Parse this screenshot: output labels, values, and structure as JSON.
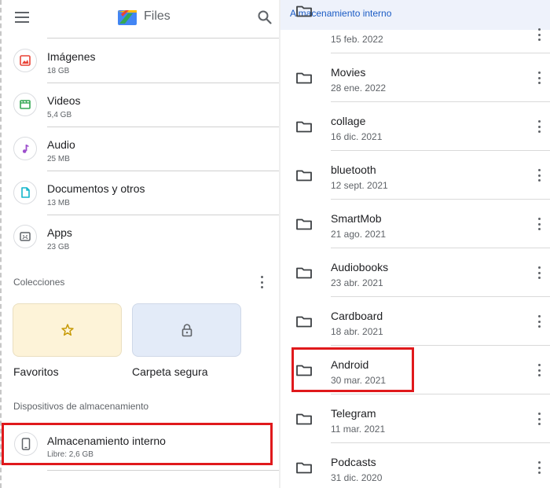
{
  "app": {
    "title": "Files"
  },
  "categories": [
    {
      "label": "Imágenes",
      "size": "18 GB",
      "icon": "image-icon",
      "color": "#e94235"
    },
    {
      "label": "Videos",
      "size": "5,4 GB",
      "icon": "video-icon",
      "color": "#34a853"
    },
    {
      "label": "Audio",
      "size": "25 MB",
      "icon": "music-note-icon",
      "color": "#9c4dcc"
    },
    {
      "label": "Documentos y otros",
      "size": "13 MB",
      "icon": "document-icon",
      "color": "#12b5cb"
    },
    {
      "label": "Apps",
      "size": "23 GB",
      "icon": "apps-icon",
      "color": "#5f6368"
    }
  ],
  "collections": {
    "label": "Colecciones",
    "items": [
      {
        "label": "Favoritos",
        "icon": "star-icon"
      },
      {
        "label": "Carpeta segura",
        "icon": "lock-icon"
      }
    ]
  },
  "storage": {
    "section_label": "Dispositivos de almacenamiento",
    "title": "Almacenamiento interno",
    "free": "Libre: 2,6 GB",
    "highlight_color": "#e0191c"
  },
  "browser": {
    "title": "Almacenamiento interno",
    "partial_date": "15 feb. 2022",
    "folders": [
      {
        "name": "Movies",
        "date": "28 ene. 2022"
      },
      {
        "name": "collage",
        "date": "16 dic. 2021"
      },
      {
        "name": "bluetooth",
        "date": "12 sept. 2021"
      },
      {
        "name": "SmartMob",
        "date": "21 ago. 2021"
      },
      {
        "name": "Audiobooks",
        "date": "23 abr. 2021"
      },
      {
        "name": "Cardboard",
        "date": "18 abr. 2021"
      },
      {
        "name": "Android",
        "date": "30 mar. 2021"
      },
      {
        "name": "Telegram",
        "date": "11 mar. 2021"
      },
      {
        "name": "Podcasts",
        "date": "31 dic. 2020"
      }
    ]
  }
}
